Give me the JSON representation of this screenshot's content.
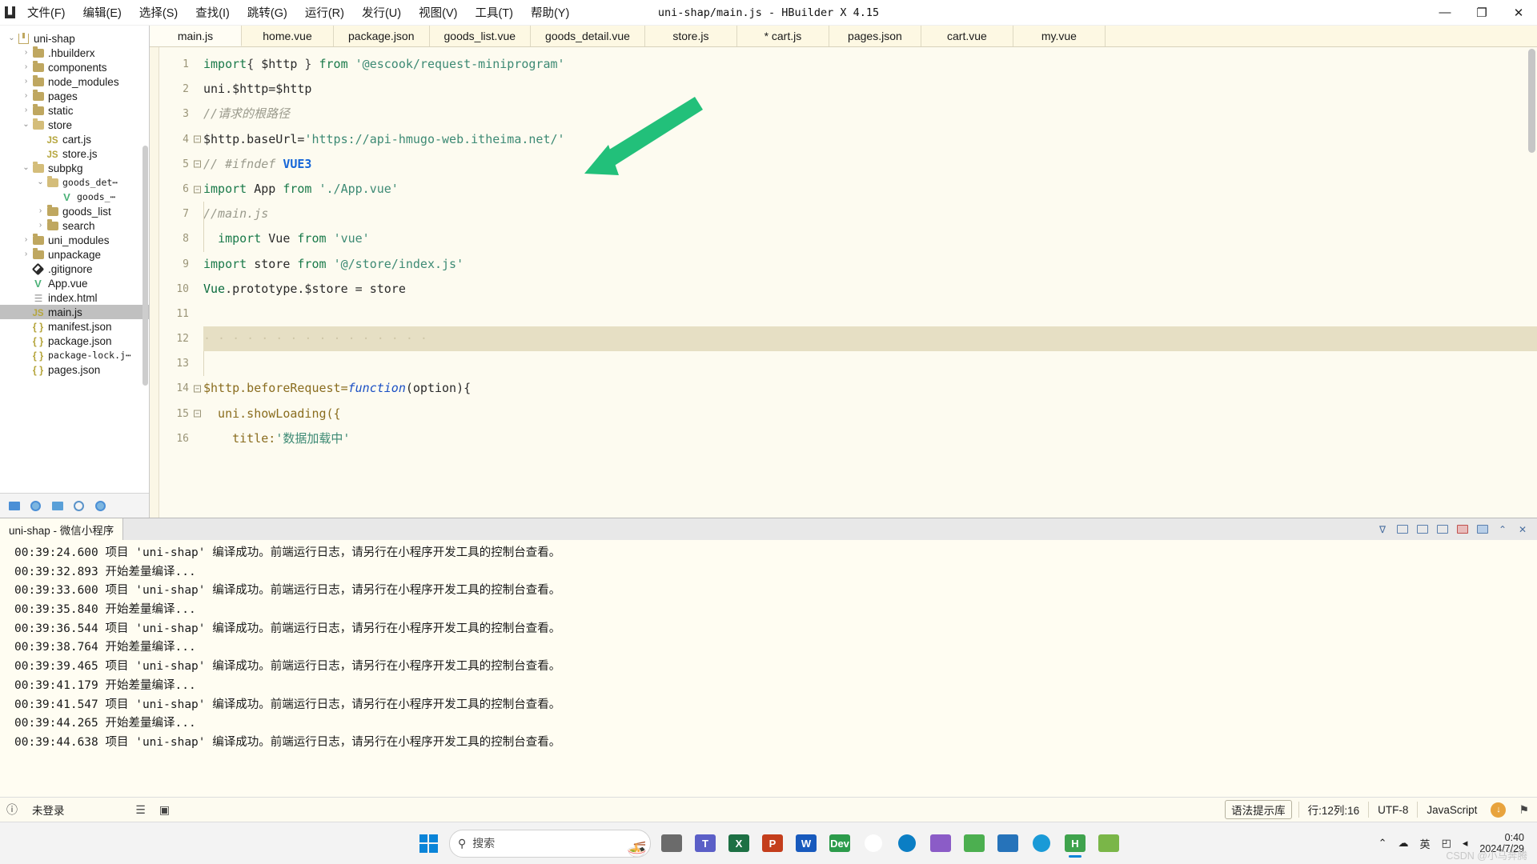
{
  "window": {
    "title": "uni-shap/main.js - HBuilder X 4.15",
    "minimize": "—",
    "maximize": "❐",
    "close": "✕"
  },
  "menubar": {
    "items": [
      {
        "label": "文件(F)",
        "name": "menu-file"
      },
      {
        "label": "编辑(E)",
        "name": "menu-edit"
      },
      {
        "label": "选择(S)",
        "name": "menu-select"
      },
      {
        "label": "查找(I)",
        "name": "menu-find"
      },
      {
        "label": "跳转(G)",
        "name": "menu-goto"
      },
      {
        "label": "运行(R)",
        "name": "menu-run"
      },
      {
        "label": "发行(U)",
        "name": "menu-publish"
      },
      {
        "label": "视图(V)",
        "name": "menu-view"
      },
      {
        "label": "工具(T)",
        "name": "menu-tools"
      },
      {
        "label": "帮助(Y)",
        "name": "menu-help"
      }
    ]
  },
  "sidebar": {
    "tree": [
      {
        "label": "uni-shap",
        "depth": 0,
        "arrow": "⌄",
        "icon": "project",
        "selected": false
      },
      {
        "label": ".hbuilderx",
        "depth": 1,
        "arrow": "›",
        "icon": "folder",
        "selected": false
      },
      {
        "label": "components",
        "depth": 1,
        "arrow": "›",
        "icon": "folder",
        "selected": false
      },
      {
        "label": "node_modules",
        "depth": 1,
        "arrow": "›",
        "icon": "folder",
        "selected": false
      },
      {
        "label": "pages",
        "depth": 1,
        "arrow": "›",
        "icon": "folder",
        "selected": false
      },
      {
        "label": "static",
        "depth": 1,
        "arrow": "›",
        "icon": "folder",
        "selected": false
      },
      {
        "label": "store",
        "depth": 1,
        "arrow": "⌄",
        "icon": "folder-open",
        "selected": false
      },
      {
        "label": "cart.js",
        "depth": 2,
        "arrow": "",
        "icon": "js",
        "selected": false
      },
      {
        "label": "store.js",
        "depth": 2,
        "arrow": "",
        "icon": "js",
        "selected": false
      },
      {
        "label": "subpkg",
        "depth": 1,
        "arrow": "⌄",
        "icon": "folder-open",
        "selected": false
      },
      {
        "label": "goods_det⋯",
        "depth": 2,
        "arrow": "⌄",
        "icon": "folder-open",
        "selected": false,
        "mono": true
      },
      {
        "label": "goods_⋯",
        "depth": 3,
        "arrow": "",
        "icon": "vue",
        "selected": false,
        "mono": true
      },
      {
        "label": "goods_list",
        "depth": 2,
        "arrow": "›",
        "icon": "folder",
        "selected": false
      },
      {
        "label": "search",
        "depth": 2,
        "arrow": "›",
        "icon": "folder",
        "selected": false
      },
      {
        "label": "uni_modules",
        "depth": 1,
        "arrow": "›",
        "icon": "folder",
        "selected": false
      },
      {
        "label": "unpackage",
        "depth": 1,
        "arrow": "›",
        "icon": "folder",
        "selected": false
      },
      {
        "label": ".gitignore",
        "depth": 1,
        "arrow": "",
        "icon": "git",
        "selected": false
      },
      {
        "label": "App.vue",
        "depth": 1,
        "arrow": "",
        "icon": "vue",
        "selected": false
      },
      {
        "label": "index.html",
        "depth": 1,
        "arrow": "",
        "icon": "html",
        "selected": false
      },
      {
        "label": "main.js",
        "depth": 1,
        "arrow": "",
        "icon": "js",
        "selected": true
      },
      {
        "label": "manifest.json",
        "depth": 1,
        "arrow": "",
        "icon": "json",
        "selected": false
      },
      {
        "label": "package.json",
        "depth": 1,
        "arrow": "",
        "icon": "json",
        "selected": false
      },
      {
        "label": "package-lock.j⋯",
        "depth": 1,
        "arrow": "",
        "icon": "json",
        "selected": false,
        "mono": true
      },
      {
        "label": "pages.json",
        "depth": 1,
        "arrow": "",
        "icon": "json",
        "selected": false
      }
    ],
    "toolbar": [
      {
        "name": "explorer-button",
        "glyph": "folder"
      },
      {
        "name": "globe-button",
        "glyph": "globe"
      },
      {
        "name": "debug-button",
        "glyph": "bug"
      },
      {
        "name": "plugin-button",
        "glyph": "circle"
      },
      {
        "name": "extension-button",
        "glyph": "circle-filled"
      }
    ]
  },
  "tabs": [
    {
      "label": "main.js",
      "active": true,
      "dirty": false
    },
    {
      "label": "home.vue",
      "active": false,
      "dirty": false
    },
    {
      "label": "package.json",
      "active": false,
      "dirty": false
    },
    {
      "label": "goods_list.vue",
      "active": false,
      "dirty": false
    },
    {
      "label": "goods_detail.vue",
      "active": false,
      "dirty": false
    },
    {
      "label": "store.js",
      "active": false,
      "dirty": false
    },
    {
      "label": "* cart.js",
      "active": false,
      "dirty": true
    },
    {
      "label": "pages.json",
      "active": false,
      "dirty": false
    },
    {
      "label": "cart.vue",
      "active": false,
      "dirty": false
    },
    {
      "label": "my.vue",
      "active": false,
      "dirty": false
    }
  ],
  "code": {
    "lines": [
      {
        "num": "1",
        "fold": "",
        "current": false,
        "tokens": [
          {
            "t": "import",
            "c": "kw"
          },
          {
            "t": "{ ",
            "c": "op"
          },
          {
            "t": "$http",
            "c": "plain"
          },
          {
            "t": " } ",
            "c": "op"
          },
          {
            "t": "from",
            "c": "kw"
          },
          {
            "t": " ",
            "c": "op"
          },
          {
            "t": "'@escook/request-miniprogram'",
            "c": "str"
          }
        ]
      },
      {
        "num": "2",
        "fold": "",
        "current": false,
        "tokens": [
          {
            "t": "uni.$http=$http",
            "c": "plain"
          }
        ]
      },
      {
        "num": "3",
        "fold": "",
        "current": false,
        "tokens": [
          {
            "t": "//请求的根路径",
            "c": "cmt"
          }
        ]
      },
      {
        "num": "4",
        "fold": "−",
        "current": false,
        "tokens": [
          {
            "t": "$http.baseUrl=",
            "c": "plain"
          },
          {
            "t": "'https://api-hmugo-web.itheima.net/'",
            "c": "str"
          }
        ]
      },
      {
        "num": "5",
        "fold": "−",
        "current": false,
        "tokens": [
          {
            "t": "// #ifndef ",
            "c": "cmt"
          },
          {
            "t": "VUE3",
            "c": "macro"
          }
        ]
      },
      {
        "num": "6",
        "fold": "−",
        "current": false,
        "tokens": [
          {
            "t": "import",
            "c": "kw"
          },
          {
            "t": " App ",
            "c": "plain"
          },
          {
            "t": "from",
            "c": "kw"
          },
          {
            "t": " ",
            "c": "op"
          },
          {
            "t": "'./App.vue'",
            "c": "str"
          }
        ]
      },
      {
        "num": "7",
        "fold": "",
        "current": false,
        "indent": true,
        "tokens": [
          {
            "t": "//main.js",
            "c": "cmt"
          }
        ]
      },
      {
        "num": "8",
        "fold": "",
        "current": false,
        "indent": true,
        "tokens": [
          {
            "t": "  ",
            "c": "op"
          },
          {
            "t": "import",
            "c": "kw"
          },
          {
            "t": " Vue ",
            "c": "plain"
          },
          {
            "t": "from",
            "c": "kw"
          },
          {
            "t": " ",
            "c": "op"
          },
          {
            "t": "'vue'",
            "c": "str"
          }
        ]
      },
      {
        "num": "9",
        "fold": "",
        "current": false,
        "tokens": [
          {
            "t": "import",
            "c": "kw"
          },
          {
            "t": " store ",
            "c": "plain"
          },
          {
            "t": "from",
            "c": "kw"
          },
          {
            "t": " ",
            "c": "op"
          },
          {
            "t": "'@/store/index.js'",
            "c": "str"
          }
        ]
      },
      {
        "num": "10",
        "fold": "",
        "current": false,
        "tokens": [
          {
            "t": "Vue",
            "c": "kw2"
          },
          {
            "t": ".prototype.$store = store",
            "c": "plain"
          }
        ]
      },
      {
        "num": "11",
        "fold": "",
        "current": false,
        "tokens": []
      },
      {
        "num": "12",
        "fold": "",
        "current": true,
        "tokens": [
          {
            "t": "· · · · · · · · · · · · · · · ·",
            "c": "ws-dots"
          }
        ]
      },
      {
        "num": "13",
        "fold": "",
        "current": false,
        "indent": true,
        "tokens": []
      },
      {
        "num": "14",
        "fold": "−",
        "current": false,
        "tokens": [
          {
            "t": "$http.beforeRequest=",
            "c": "prop"
          },
          {
            "t": "function",
            "c": "fn"
          },
          {
            "t": "(option){",
            "c": "plain"
          }
        ]
      },
      {
        "num": "15",
        "fold": "−",
        "current": false,
        "tokens": [
          {
            "t": "  uni.showLoading({",
            "c": "prop"
          }
        ]
      },
      {
        "num": "16",
        "fold": "",
        "current": false,
        "tokens": [
          {
            "t": "    title:",
            "c": "prop"
          },
          {
            "t": "'数据加载中'",
            "c": "str"
          }
        ]
      }
    ],
    "annotation": {
      "name": "green-arrow-annotation",
      "color": "#22c07a"
    }
  },
  "console": {
    "tab": "uni-shap - 微信小程序",
    "tools": [
      {
        "name": "filter-icon",
        "glyph": "∇"
      },
      {
        "name": "panel-left-icon",
        "glyph": "box"
      },
      {
        "name": "panel-right-icon",
        "glyph": "box"
      },
      {
        "name": "panel-split-icon",
        "glyph": "box"
      },
      {
        "name": "clear-console-icon",
        "glyph": "box-red"
      },
      {
        "name": "settings-icon",
        "glyph": "box-blue"
      },
      {
        "name": "collapse-icon",
        "glyph": "⌃"
      },
      {
        "name": "close-panel-icon",
        "glyph": "✕"
      }
    ],
    "lines": [
      "00:39:24.600 项目 'uni-shap' 编译成功。前端运行日志，请另行在小程序开发工具的控制台查看。",
      "00:39:32.893 开始差量编译...",
      "00:39:33.600 项目 'uni-shap' 编译成功。前端运行日志，请另行在小程序开发工具的控制台查看。",
      "00:39:35.840 开始差量编译...",
      "00:39:36.544 项目 'uni-shap' 编译成功。前端运行日志，请另行在小程序开发工具的控制台查看。",
      "00:39:38.764 开始差量编译...",
      "00:39:39.465 项目 'uni-shap' 编译成功。前端运行日志，请另行在小程序开发工具的控制台查看。",
      "00:39:41.179 开始差量编译...",
      "00:39:41.547 项目 'uni-shap' 编译成功。前端运行日志，请另行在小程序开发工具的控制台查看。",
      "00:39:44.265 开始差量编译...",
      "00:39:44.638 项目 'uni-shap' 编译成功。前端运行日志，请另行在小程序开发工具的控制台查看。"
    ]
  },
  "statusbar": {
    "info_icon": "ⓘ",
    "login": "未登录",
    "list_icon": "☰",
    "grid_icon": "▣",
    "syntax_lib": "语法提示库",
    "cursor": "行:12列:16",
    "encoding": "UTF-8",
    "language": "JavaScript",
    "download_badge": "↓",
    "bell": "⚑"
  },
  "taskbar": {
    "search_placeholder": "搜索",
    "search_icon": "⚲",
    "items": [
      {
        "name": "taskview-button",
        "label": "",
        "color": "#6b6b6b",
        "glyph": "tiles"
      },
      {
        "name": "teams-button",
        "label": "T",
        "color": "#5b5fc7"
      },
      {
        "name": "excel-button",
        "label": "X",
        "color": "#1d7044"
      },
      {
        "name": "powerpoint-button",
        "label": "P",
        "color": "#c43e1c"
      },
      {
        "name": "word-button",
        "label": "W",
        "color": "#185abd"
      },
      {
        "name": "devtools-button",
        "label": "Dev",
        "color": "#2c9b4b"
      },
      {
        "name": "chrome-button",
        "label": "",
        "color": "#ffffff",
        "glyph": "chrome"
      },
      {
        "name": "edge-dev-button",
        "label": "",
        "color": "#0b7ec4",
        "glyph": "circle"
      },
      {
        "name": "vs-button",
        "label": "",
        "color": "#8b5cc7",
        "glyph": "vs"
      },
      {
        "name": "wechat-button",
        "label": "",
        "color": "#4caf50",
        "glyph": "wechat"
      },
      {
        "name": "vscode-button",
        "label": "",
        "color": "#2673ba",
        "glyph": "code"
      },
      {
        "name": "edge-button",
        "label": "",
        "color": "#1a9ad7",
        "glyph": "edge"
      },
      {
        "name": "hbuilder-button",
        "label": "H",
        "color": "#3fa34d",
        "active": true
      },
      {
        "name": "misc-button",
        "label": "",
        "color": "#7ab648",
        "glyph": "leaf"
      }
    ],
    "tray": {
      "chevron": "⌃",
      "cloud": "☁",
      "ime": "英",
      "wifi": "◰",
      "volume": "◂",
      "time": "0:40",
      "date": "2024/7/29"
    },
    "watermark": "CSDN @小马奔腾"
  }
}
